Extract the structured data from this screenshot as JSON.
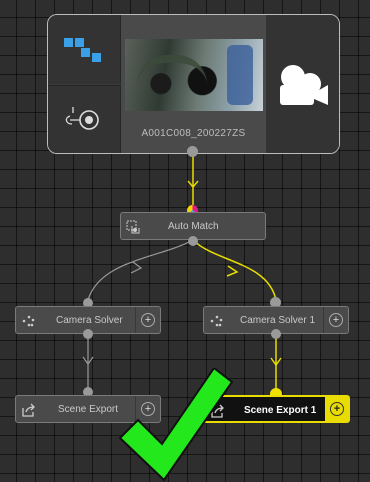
{
  "media_node": {
    "clip_name": "A001C008_200227ZS",
    "left_top_icon": "blocks-icon",
    "left_bottom_icon": "camera-track-icon",
    "right_icon": "movie-camera-icon"
  },
  "nodes": {
    "auto_match": {
      "label": "Auto Match",
      "icon": "match-icon"
    },
    "camera_solver_left": {
      "label": "Camera Solver",
      "icon": "solver-points-icon",
      "add": "+"
    },
    "camera_solver_right": {
      "label": "Camera Solver 1",
      "icon": "solver-points-icon",
      "add": "+"
    },
    "scene_export_left": {
      "label": "Scene Export",
      "icon": "export-icon",
      "add": "+"
    },
    "scene_export_right": {
      "label": "Scene Export 1",
      "icon": "export-icon",
      "add": "+",
      "selected": true
    }
  },
  "overlay": {
    "icon": "checkmark-icon",
    "color": "#22e81c"
  },
  "colors": {
    "active_wire": "#e8dc00",
    "inactive_wire": "#9a9a9a",
    "node_bg": "#4a4a4a",
    "canvas_bg": "#2e2e2e"
  }
}
